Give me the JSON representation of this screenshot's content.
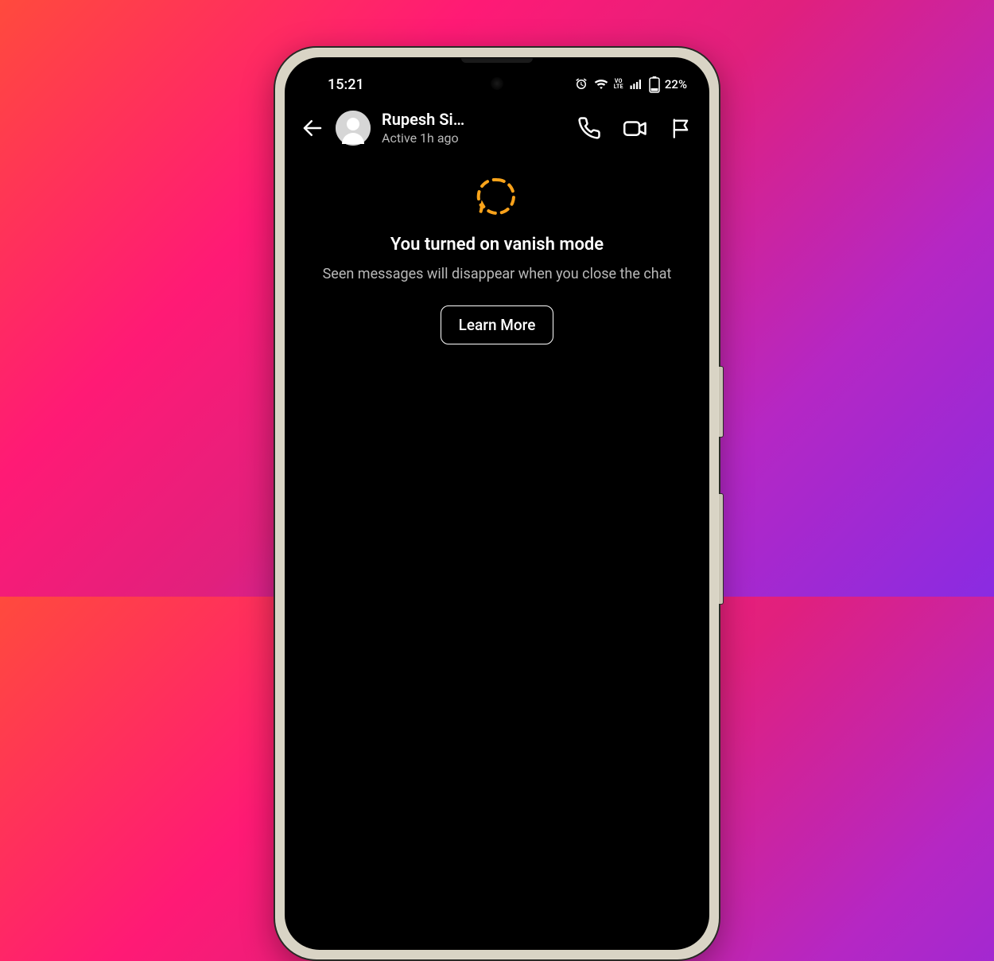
{
  "status_bar": {
    "time": "15:21",
    "battery_text": "22%",
    "network_badge": "VO LTE"
  },
  "chat": {
    "contact_name": "Rupesh Si…",
    "activity": "Active 1h ago"
  },
  "vanish": {
    "title": "You turned on vanish mode",
    "description": "Seen messages will disappear when you close the chat",
    "learn_more_label": "Learn More"
  }
}
